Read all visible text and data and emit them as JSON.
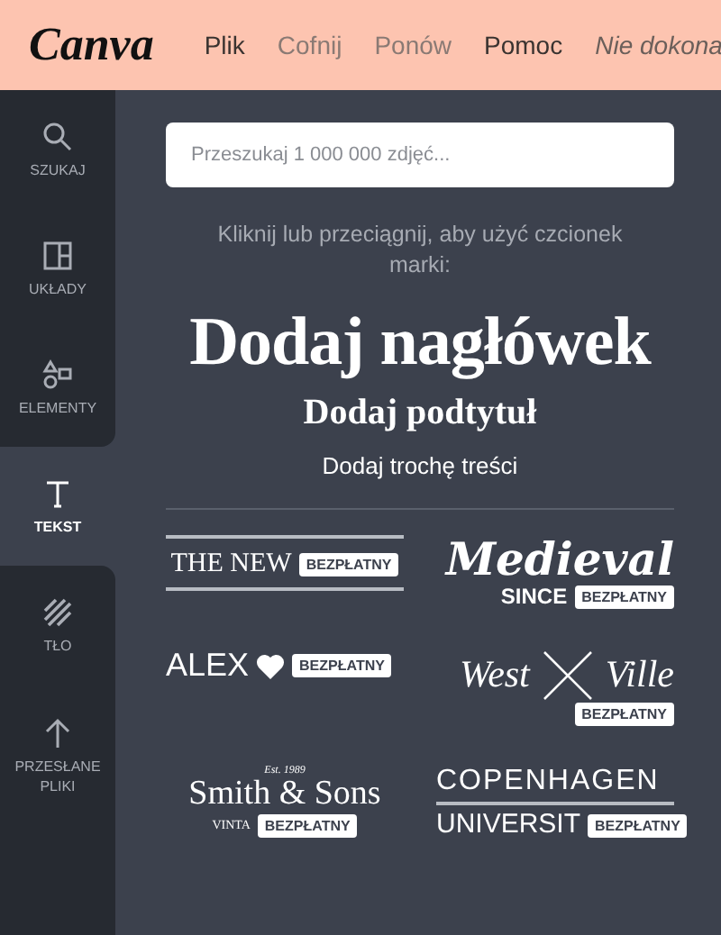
{
  "header": {
    "logo": "Canva",
    "menu": [
      {
        "label": "Plik",
        "disabled": false
      },
      {
        "label": "Cofnij",
        "disabled": true
      },
      {
        "label": "Ponów",
        "disabled": true
      },
      {
        "label": "Pomoc",
        "disabled": false
      }
    ],
    "status": "Nie dokona"
  },
  "sidebar": {
    "items": [
      {
        "label": "SZUKAJ",
        "kind": "search",
        "selected": false
      },
      {
        "label": "UKŁADY",
        "kind": "layout",
        "selected": false
      },
      {
        "label": "ELEMENTY",
        "kind": "shapes",
        "selected": false
      },
      {
        "label": "TEKST",
        "kind": "text",
        "selected": true
      },
      {
        "label": "TŁO",
        "kind": "stripes",
        "selected": false
      },
      {
        "label": "PRZESŁANE PLIKI",
        "kind": "upload",
        "selected": false
      }
    ]
  },
  "panel": {
    "search": {
      "placeholder": "Przeszukaj 1 000 000 zdjęć..."
    },
    "hint": "Kliknij lub przeciągnij, aby użyć czcionek marki:",
    "text_styles": [
      {
        "kind": "heading",
        "label": "Dodaj nagłówek"
      },
      {
        "kind": "subheading",
        "label": "Dodaj podtytuł"
      },
      {
        "kind": "body",
        "label": "Dodaj trochę treści"
      }
    ],
    "templates": [
      {
        "kind": "newyou",
        "texts": [
          "THE NEW"
        ],
        "badge": "BEZPŁATNY"
      },
      {
        "kind": "medieval",
        "texts": [
          "Medieval",
          "SINCE"
        ],
        "badge": "BEZPŁATNY"
      },
      {
        "kind": "alex",
        "texts": [
          "ALEX"
        ],
        "badge": "BEZPŁATNY"
      },
      {
        "kind": "west",
        "texts": [
          "West",
          "Ville"
        ],
        "badge": "BEZPŁATNY"
      },
      {
        "kind": "smith",
        "texts": [
          "Est. 1989",
          "Smith & Sons",
          "VINTA"
        ],
        "badge": "BEZPŁATNY"
      },
      {
        "kind": "copenhagen",
        "texts": [
          "COPENHAGEN",
          "UNIVERSIT"
        ],
        "badge": "BEZPŁATNY"
      }
    ]
  }
}
